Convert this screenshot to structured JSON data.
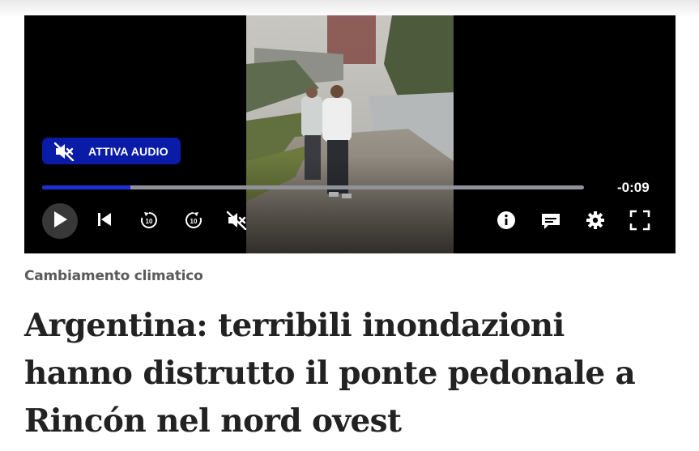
{
  "player": {
    "audio_button_label": "ATTIVA AUDIO",
    "time_remaining": "-0:09",
    "progress": 0.163,
    "icons": {
      "muted": "speaker-muted-icon",
      "play": "play-icon",
      "previous": "skip-previous-icon",
      "rewind": "rewind-10-icon",
      "forward": "forward-10-icon",
      "info": "info-icon",
      "subtitles": "subtitles-icon",
      "settings": "gear-icon",
      "fullscreen": "fullscreen-icon"
    },
    "colors": {
      "accent": "#0a1ba8",
      "progress_fill": "#1c2fd6",
      "progress_track": "#8f9399"
    }
  },
  "article": {
    "category": "Cambiamento climatico",
    "headline": "Argentina: terribili inondazioni hanno distrutto il ponte pedonale a Rincón nel nord ovest"
  }
}
